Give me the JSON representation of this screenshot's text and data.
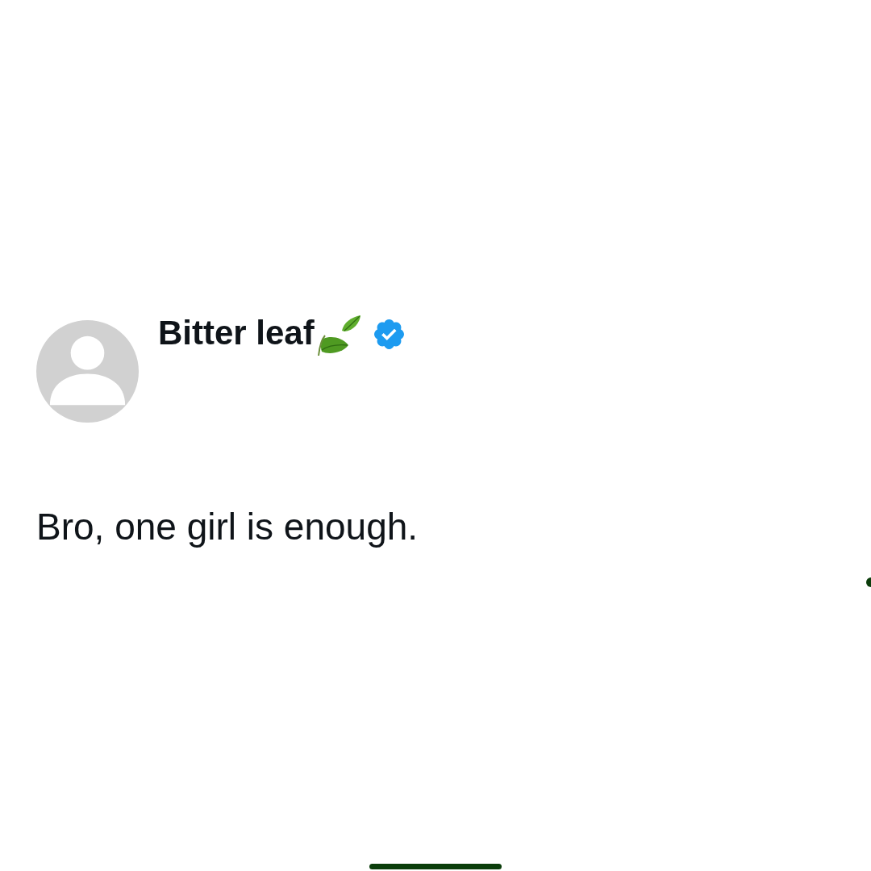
{
  "post": {
    "author": {
      "name": "Bitter leaf",
      "verified": true
    },
    "text": "Bro, one girl is enough."
  }
}
